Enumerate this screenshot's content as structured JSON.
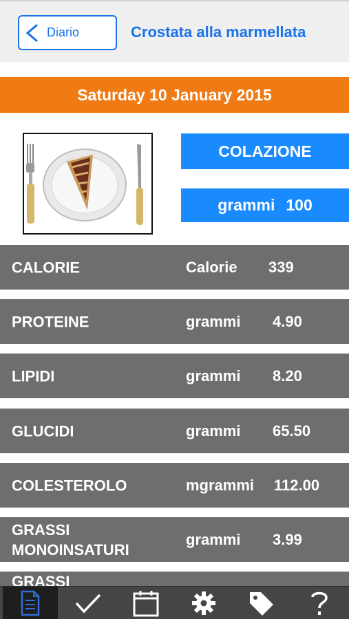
{
  "header": {
    "back_label": "Diario",
    "title": "Crostata alla marmellata"
  },
  "date_label": "Saturday 10 January 2015",
  "food": {
    "image_icon": "tart-on-plate-icon"
  },
  "meal_button": "COLAZIONE",
  "quantity": {
    "unit": "grammi",
    "value": "100"
  },
  "nutrients": [
    {
      "name": "CALORIE",
      "unit": "Calorie",
      "value": "339"
    },
    {
      "name": "PROTEINE",
      "unit": "grammi",
      "value": "4.90"
    },
    {
      "name": "LIPIDI",
      "unit": "grammi",
      "value": "8.20"
    },
    {
      "name": "GLUCIDI",
      "unit": "grammi",
      "value": "65.50"
    },
    {
      "name": "COLESTEROLO",
      "unit": "mgrammi",
      "value": "112.00"
    },
    {
      "name": "GRASSI MONOINSATURI",
      "unit": "grammi",
      "value": "3.99"
    },
    {
      "name": "GRASSI",
      "unit": "",
      "value": ""
    }
  ],
  "tabs": [
    {
      "icon": "diary-document-icon",
      "active": true
    },
    {
      "icon": "checkmark-icon",
      "active": false
    },
    {
      "icon": "calendar-icon",
      "active": false
    },
    {
      "icon": "gear-icon",
      "active": false
    },
    {
      "icon": "tag-icon",
      "active": false
    },
    {
      "icon": "help-question-icon",
      "active": false
    }
  ],
  "colors": {
    "accent_blue": "#1a8aff",
    "date_orange": "#f07a14",
    "row_gray": "#6e6e6e",
    "tabbar": "#454545"
  }
}
